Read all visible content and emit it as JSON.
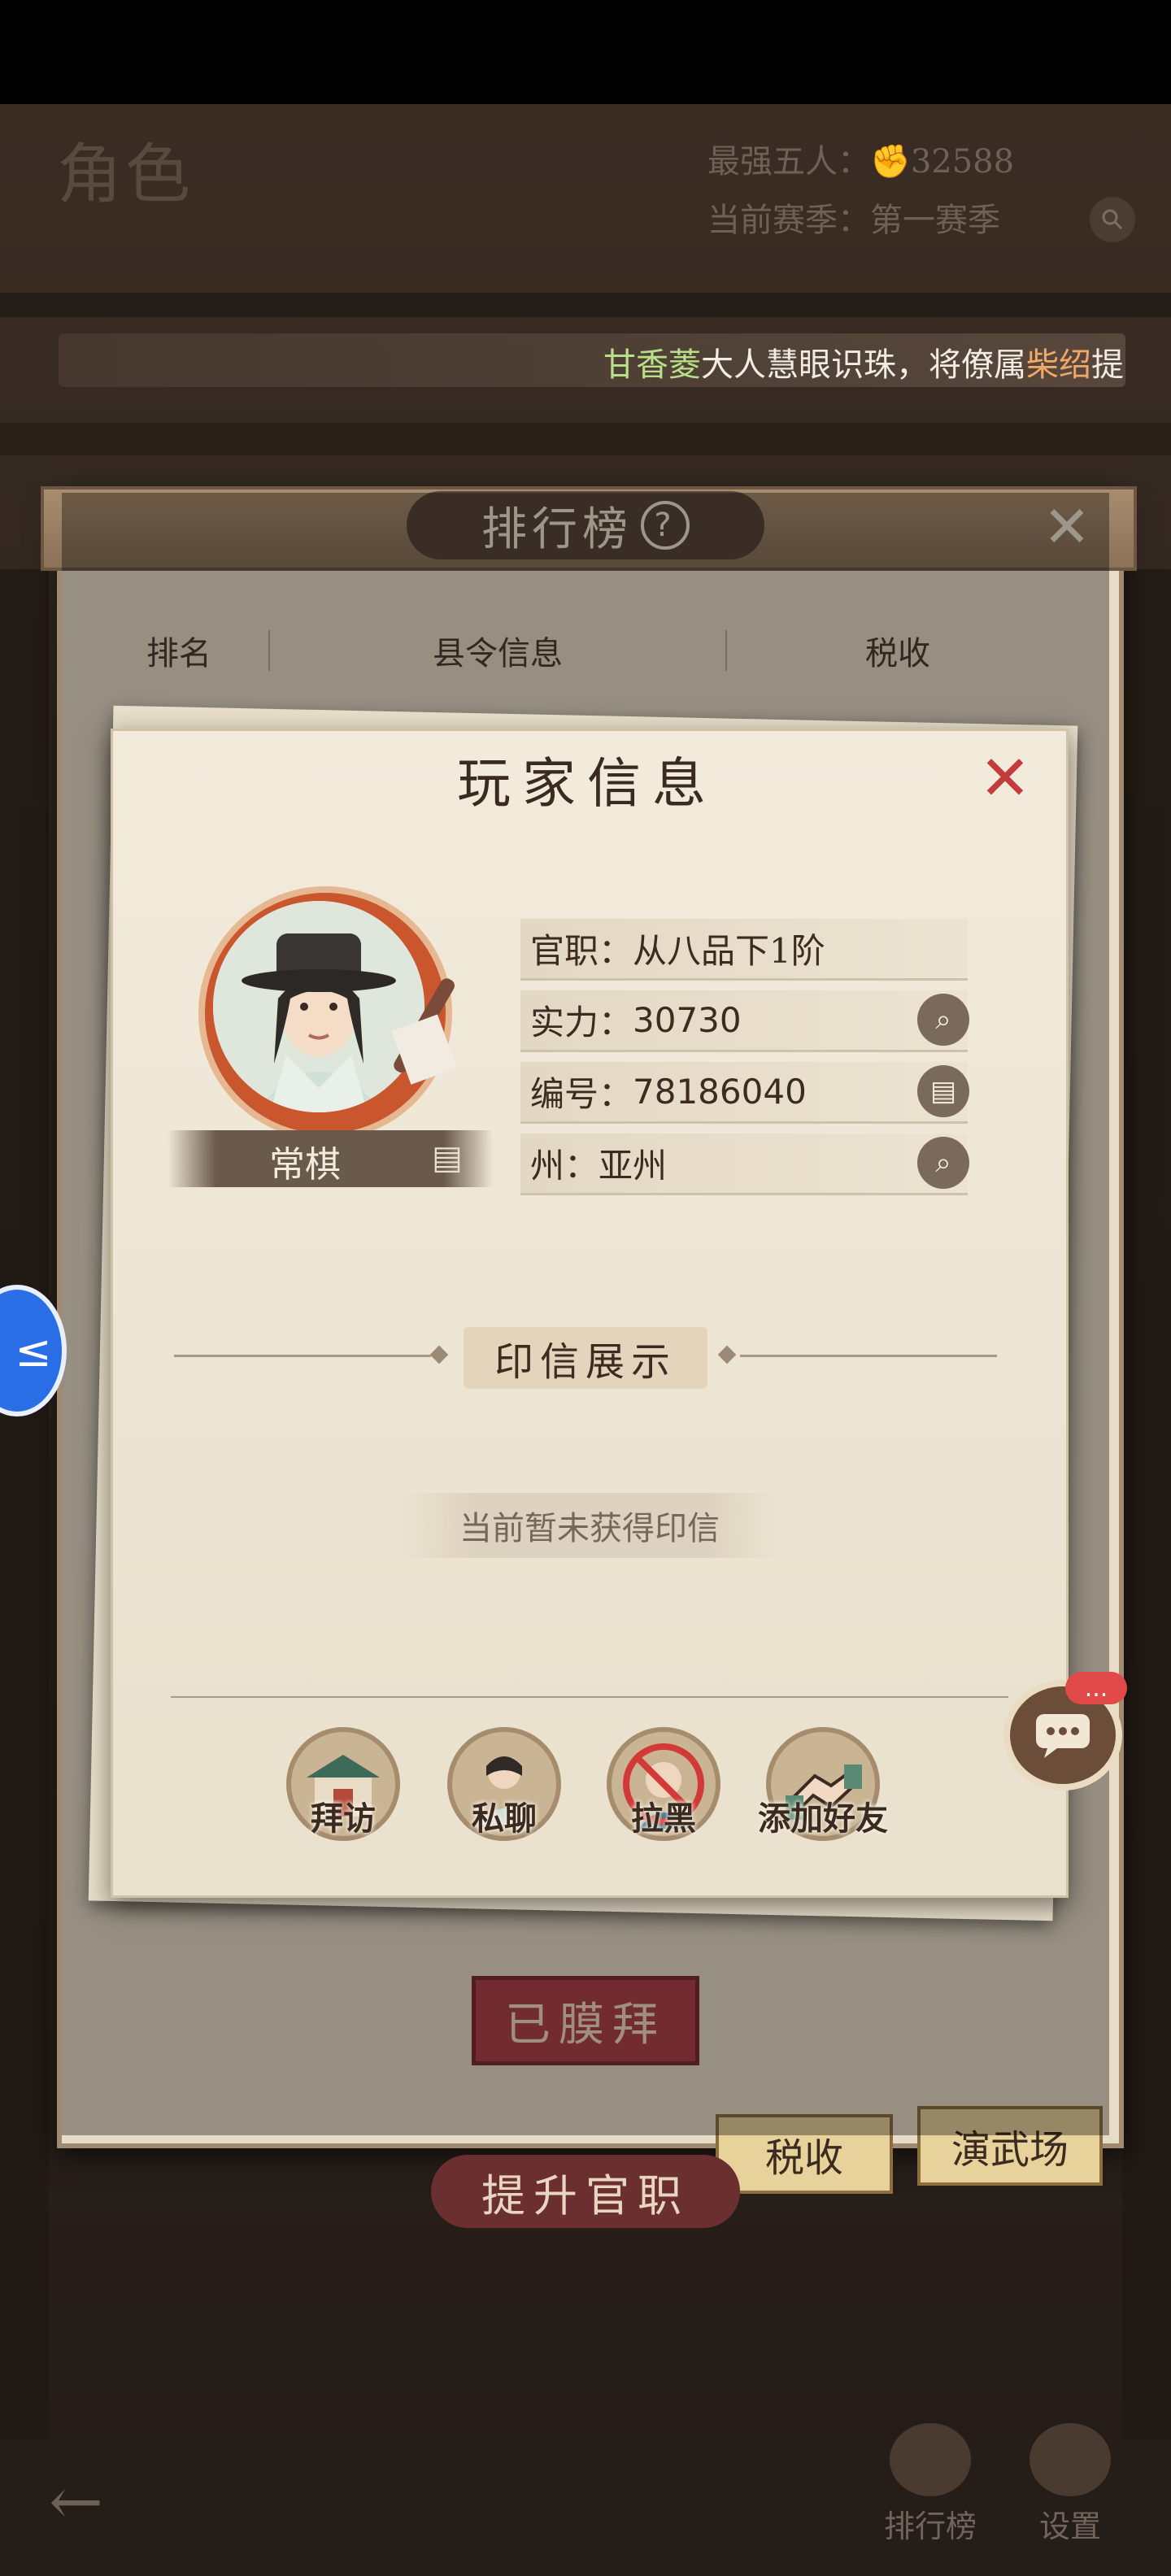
{
  "top_header": {
    "title": "角色",
    "top_five_label": "最强五人：",
    "top_five_value": "32588",
    "season_label": "当前赛季：",
    "season_value": "第一赛季"
  },
  "ticker": {
    "name1": "甘香菱",
    "middle": "大人慧眼识珠，将僚属",
    "name2": "柴绍",
    "tail": "提"
  },
  "leaderboard": {
    "title": "排行榜",
    "help": "?",
    "columns": [
      "排名",
      "县令信息",
      "税收"
    ],
    "worship_button": "已膜拜",
    "tabs": [
      "税收",
      "演武场"
    ],
    "promote_button": "提升官职"
  },
  "player_info": {
    "title": "玩家信息",
    "name": "常棋",
    "rows": [
      {
        "label": "官职：",
        "value": "从八品下1阶"
      },
      {
        "label": "实力：",
        "value": "30730"
      },
      {
        "label": "编号：",
        "value": "78186040"
      },
      {
        "label": "州：",
        "value": "亚州"
      }
    ],
    "seal_section_title": "印信展示",
    "seal_empty": "当前暂未获得印信",
    "actions": [
      "拜访",
      "私聊",
      "拉黑",
      "添加好友"
    ]
  },
  "chat_badge": "...",
  "bottom_nav": [
    "排行榜",
    "设置"
  ]
}
